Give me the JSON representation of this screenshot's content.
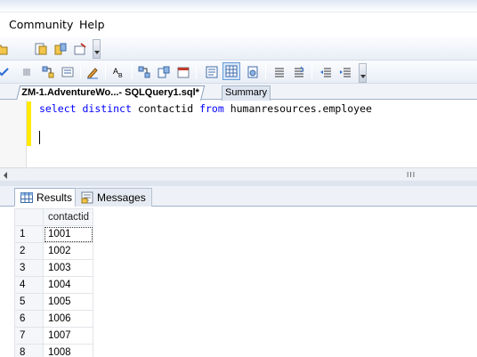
{
  "menubar": {
    "items": [
      "Community",
      "Help"
    ]
  },
  "editor": {
    "tabs": [
      {
        "label": "ZM-1.AdventureWo...- SQLQuery1.sql*",
        "active": true
      },
      {
        "label": "Summary",
        "active": false
      }
    ],
    "query": {
      "keyword_select": "select",
      "keyword_distinct": "distinct",
      "column": "contactid",
      "keyword_from": "from",
      "table": "humanresources.employee"
    }
  },
  "results": {
    "tabs": [
      {
        "label": "Results",
        "icon": "grid-icon"
      },
      {
        "label": "Messages",
        "icon": "messages-icon"
      }
    ],
    "columns": [
      "contactid"
    ],
    "rows": [
      {
        "n": "1",
        "contactid": "1001"
      },
      {
        "n": "2",
        "contactid": "1002"
      },
      {
        "n": "3",
        "contactid": "1003"
      },
      {
        "n": "4",
        "contactid": "1004"
      },
      {
        "n": "5",
        "contactid": "1005"
      },
      {
        "n": "6",
        "contactid": "1006"
      },
      {
        "n": "7",
        "contactid": "1007"
      },
      {
        "n": "8",
        "contactid": "1008"
      }
    ]
  },
  "colors": {
    "keyword": "#0000ff",
    "change_bar": "#ffea00"
  }
}
